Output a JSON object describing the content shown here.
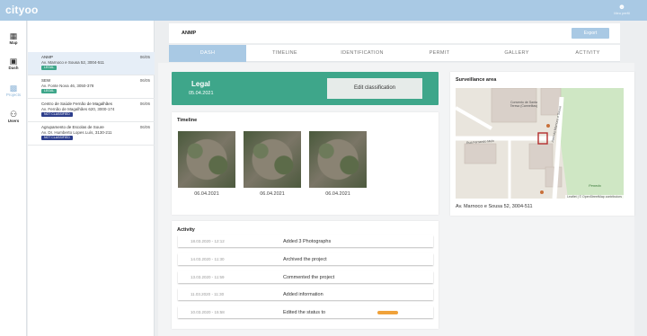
{
  "app": {
    "logo": "cityoo",
    "user_label": "Meu perfil"
  },
  "rail": [
    {
      "label": "Map",
      "icon": "map-icon"
    },
    {
      "label": "Dash",
      "icon": "dashboard-icon"
    },
    {
      "label": "Projects",
      "icon": "projects-icon"
    },
    {
      "label": "Users",
      "icon": "users-icon"
    }
  ],
  "projects": [
    {
      "title": "ANMP",
      "address": "Av. Marnoco e Sousa 52, 3004-511",
      "date": "06/05",
      "badge": "LEGAL",
      "badge_type": "legal"
    },
    {
      "title": "SEW",
      "address": "Av. Fonte Nova 46, 3050-378",
      "date": "06/05",
      "badge": "LEGAL",
      "badge_type": "legal"
    },
    {
      "title": "Centro de Saúde Fernão de Magalhães",
      "address": "Av. Fernão de Magalhães 620, 3000-174",
      "date": "06/06",
      "badge": "NOT CLASSIFIED",
      "badge_type": "nc"
    },
    {
      "title": "Agrupamento de Escolas de Soure",
      "address": "Av. Dr. Humberto Lopes Luís, 3130-211",
      "date": "06/06",
      "badge": "NOT CLASSIFIED",
      "badge_type": "nc"
    }
  ],
  "header": {
    "title": "ANMP",
    "export_label": "Export"
  },
  "tabs": [
    "DASH",
    "TIMELINE",
    "IDENTIFICATION",
    "PERMIT",
    "GALLERY",
    "ACTIVITY"
  ],
  "classification": {
    "status": "Legal",
    "date": "05.04.2021",
    "edit_label": "Edit classification"
  },
  "timeline": {
    "title": "Timeline",
    "photos": [
      {
        "date": "06.04.2021"
      },
      {
        "date": "06.04.2021"
      },
      {
        "date": "06.04.2021"
      }
    ]
  },
  "activity": {
    "title": "Activity",
    "rows": [
      {
        "date": "18.03.2020 - 12:12",
        "text": "Added 3 Photographs"
      },
      {
        "date": "14.03.2020 - 11:30",
        "text": "Archived the project"
      },
      {
        "date": "13.03.2020 - 11:59",
        "text": "Commented the project"
      },
      {
        "date": "11.03.2020 - 11:30",
        "text": "Added information"
      },
      {
        "date": "10.03.2020 - 15:58",
        "text": "Edited the status to"
      }
    ]
  },
  "surveillance": {
    "title": "Surveillance area",
    "address": "Av. Marnoco e Sousa 52, 3004-511",
    "map_labels": {
      "place": "Convento de Santa Teresa (Carmelitas)",
      "street1": "Rua Fernando Melo",
      "street2": "Avenida Marnoco e Sousa",
      "park": "Penedo",
      "attribution": "Leaflet | © OpenStreetMap contributors"
    }
  },
  "colors": {
    "accent": "#a9c9e4",
    "legal": "#3ea68a",
    "not_classified": "#2d3e8c",
    "status_pill": "#f0a23a"
  }
}
